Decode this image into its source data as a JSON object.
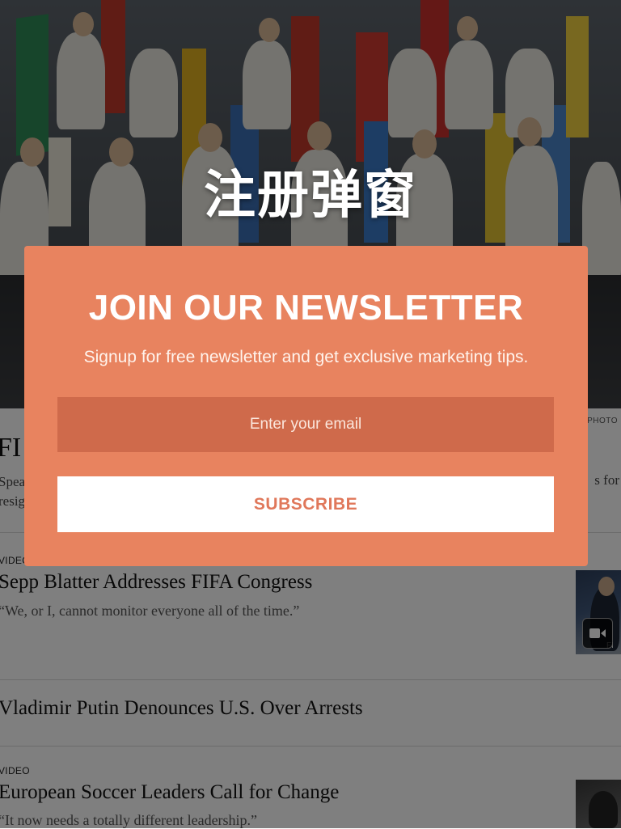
{
  "overlay_caption": "注册弹窗",
  "article_page": {
    "photo_credit": "PHOTO",
    "lead_story": {
      "headline_fragment": "FI",
      "summary_line1": "Spea",
      "summary_line2": "resig",
      "summary_right_fragment": "s for"
    },
    "stories": [
      {
        "kicker": "VIDEO",
        "title": "Sepp Blatter Addresses FIFA Congress",
        "summary": "“We, or I, cannot monitor everyone all of the time.”"
      },
      {
        "kicker": "",
        "title": "Vladimir Putin Denounces U.S. Over Arrests",
        "summary": ""
      },
      {
        "kicker": "VIDEO",
        "title": "European Soccer Leaders Call for Change",
        "summary": "“It now needs a totally different leadership.”"
      }
    ],
    "thumb_caption": "FI"
  },
  "newsletter_modal": {
    "title": "JOIN OUR NEWSLETTER",
    "subtitle": "Signup for free newsletter and get exclusive marketing tips.",
    "email_placeholder": "Enter your email",
    "email_value": "",
    "subscribe_label": "SUBSCRIBE",
    "colors": {
      "modal_background": "#e8835f",
      "input_background": "#cf6a4b",
      "button_background": "#ffffff",
      "button_text": "#e0785b"
    }
  }
}
